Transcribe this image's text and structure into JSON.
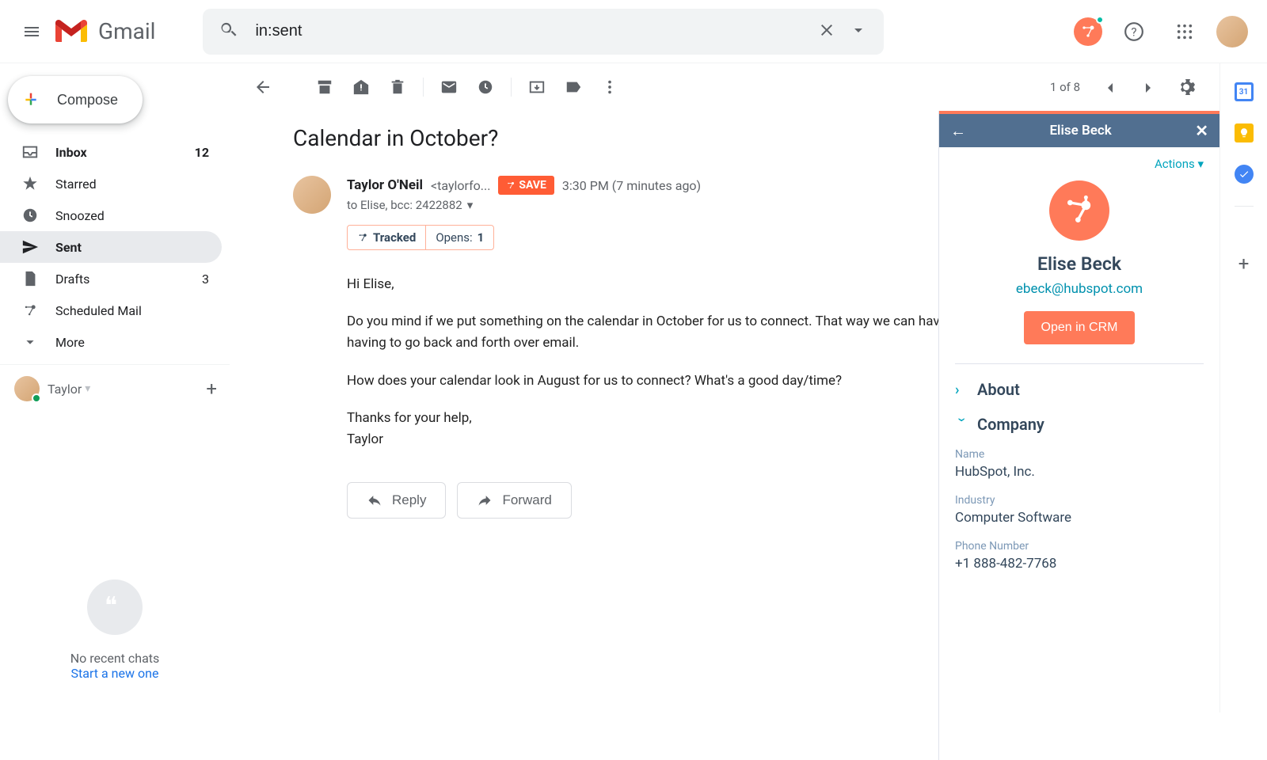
{
  "header": {
    "app_name": "Gmail",
    "search_value": "in:sent"
  },
  "sidebar": {
    "compose": "Compose",
    "items": [
      {
        "label": "Inbox",
        "count": "12",
        "bold": true
      },
      {
        "label": "Starred"
      },
      {
        "label": "Snoozed"
      },
      {
        "label": "Sent"
      },
      {
        "label": "Drafts",
        "count": "3"
      },
      {
        "label": "Scheduled Mail"
      },
      {
        "label": "More"
      }
    ],
    "user": "Taylor",
    "hangouts_empty": "No recent chats",
    "hangouts_cta": "Start a new one"
  },
  "toolbar": {
    "page_info": "1 of 8"
  },
  "email": {
    "subject": "Calendar in October?",
    "sender_name": "Taylor O'Neil",
    "sender_email": "<taylorfo...",
    "save_badge": "SAVE",
    "timestamp": "3:30 PM (7 minutes ago)",
    "recipients": "to Elise, bcc: 2422882",
    "tracked_label": "Tracked",
    "opens_label": "Opens:",
    "opens_count": "1",
    "body_p1": "Hi Elise,",
    "body_p2": "Do you mind if we put something on the calendar in October for us to connect. That way we can have a quick check-in call rather than having to go back and forth over email.",
    "body_p3": "How does your calendar look in August for us to connect? What's a good day/time?",
    "body_p4": "Thanks for your help,",
    "body_p5": "Taylor",
    "reply_label": "Reply",
    "forward_label": "Forward"
  },
  "hubspot": {
    "header_title": "Elise Beck",
    "actions_label": "Actions",
    "contact_name": "Elise Beck",
    "contact_email": "ebeck@hubspot.com",
    "crm_button": "Open in CRM",
    "about_section": "About",
    "company_section": "Company",
    "fields": {
      "name_label": "Name",
      "name_value": "HubSpot, Inc.",
      "industry_label": "Industry",
      "industry_value": "Computer Software",
      "phone_label": "Phone Number",
      "phone_value": "+1 888-482-7768"
    }
  }
}
